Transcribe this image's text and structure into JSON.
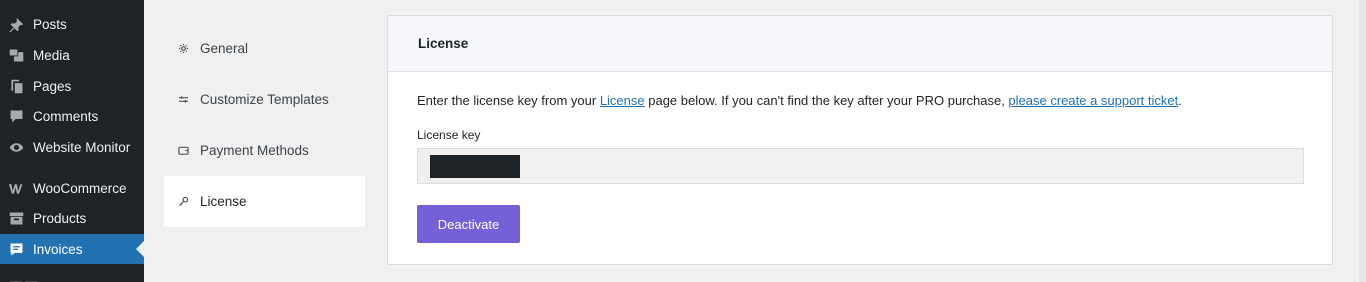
{
  "wp_menu": {
    "items": [
      {
        "label": "Posts",
        "icon": "pin-icon"
      },
      {
        "label": "Media",
        "icon": "media-icon"
      },
      {
        "label": "Pages",
        "icon": "pages-icon"
      },
      {
        "label": "Comments",
        "icon": "comments-icon"
      },
      {
        "label": "Website Monitor",
        "icon": "eye-icon"
      },
      {
        "label": "WooCommerce",
        "icon": "woo-icon"
      },
      {
        "label": "Products",
        "icon": "archive-icon"
      },
      {
        "label": "Invoices",
        "icon": "invoice-icon"
      }
    ],
    "active_index": 7,
    "active_color": "#2271b1"
  },
  "plugin_nav": {
    "items": [
      {
        "label": "General",
        "icon": "gear-icon"
      },
      {
        "label": "Customize Templates",
        "icon": "sliders-icon"
      },
      {
        "label": "Payment Methods",
        "icon": "wallet-icon"
      },
      {
        "label": "License",
        "icon": "key-icon"
      }
    ],
    "active_index": 3
  },
  "panel": {
    "title": "License",
    "desc_part1": "Enter the license key from your ",
    "desc_link1": "License",
    "desc_part2": " page below. If you can't find the key after your PRO purchase, ",
    "desc_link2": "please create a support ticket",
    "desc_part3": ".",
    "field_label": "License key",
    "button_label": "Deactivate",
    "button_color": "#7560d8"
  }
}
